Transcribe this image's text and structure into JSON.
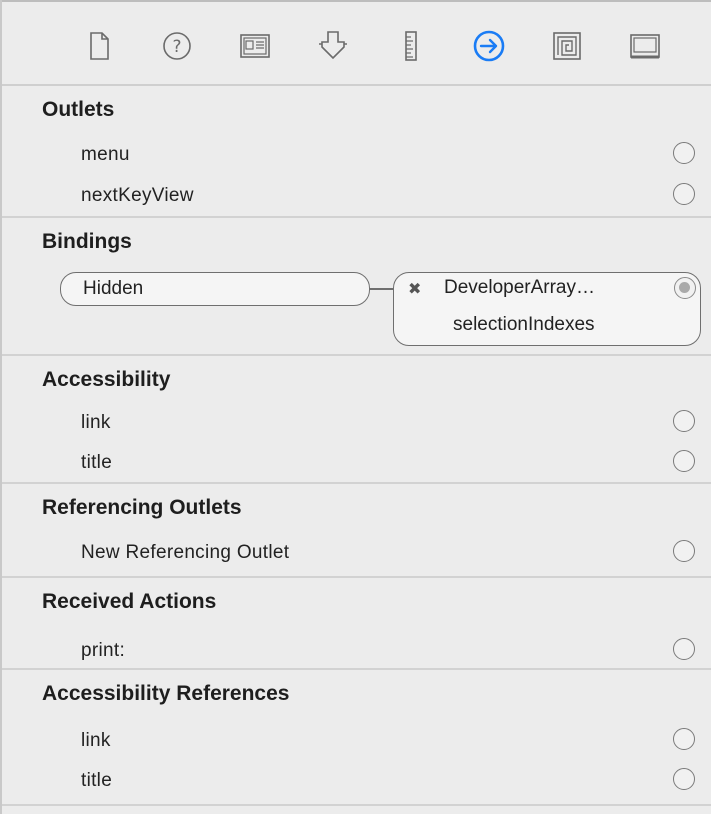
{
  "toolbar": {
    "tabs": [
      {
        "icon": "file-icon"
      },
      {
        "icon": "help-icon"
      },
      {
        "icon": "identity-icon"
      },
      {
        "icon": "attributes-icon"
      },
      {
        "icon": "size-ruler-icon"
      },
      {
        "icon": "connections-arrow-icon",
        "active": true
      },
      {
        "icon": "bindings-icon"
      },
      {
        "icon": "view-effects-icon"
      }
    ],
    "accent_color": "#1a7cf5"
  },
  "sections": {
    "outlets": {
      "title": "Outlets",
      "items": [
        "menu",
        "nextKeyView"
      ]
    },
    "bindings": {
      "title": "Bindings",
      "binding": {
        "attribute": "Hidden",
        "controller": "DeveloperArray…",
        "key_path": "selectionIndexes",
        "remove_glyph": "✖"
      }
    },
    "accessibility": {
      "title": "Accessibility",
      "items": [
        "link",
        "title"
      ]
    },
    "referencing_outlets": {
      "title": "Referencing Outlets",
      "items": [
        "New Referencing Outlet"
      ]
    },
    "received_actions": {
      "title": "Received Actions",
      "items": [
        "print:"
      ]
    },
    "accessibility_references": {
      "title": "Accessibility References",
      "items": [
        "link",
        "title"
      ]
    }
  }
}
